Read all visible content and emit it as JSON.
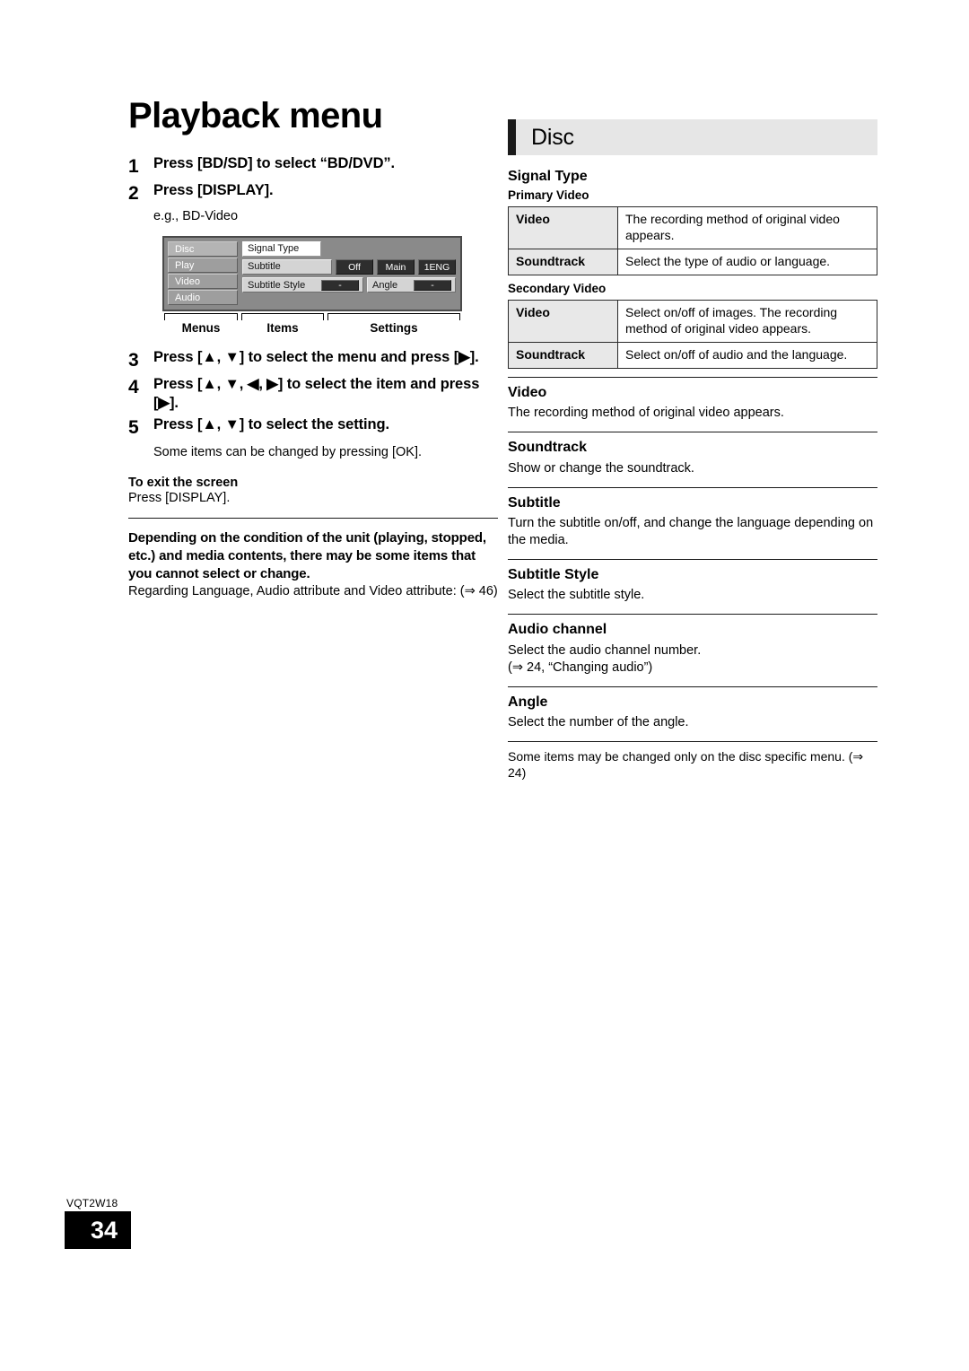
{
  "page": {
    "title": "Playback menu",
    "model_code": "VQT2W18",
    "page_number": "34"
  },
  "steps": [
    {
      "num": "1",
      "text": "Press [BD/SD] to select “BD/DVD”."
    },
    {
      "num": "2",
      "text": "Press [DISPLAY].",
      "sub": "e.g., BD-Video"
    },
    {
      "num": "3",
      "text": "Press [▲, ▼] to select the menu and press [▶]."
    },
    {
      "num": "4",
      "text": "Press [▲, ▼, ◀, ▶] to select the item and press [▶]."
    },
    {
      "num": "5",
      "text": "Press [▲, ▼] to select the setting.",
      "sub": "Some items can be changed by pressing [OK]."
    }
  ],
  "osd": {
    "menus": [
      {
        "label": "Disc",
        "selected": true
      },
      {
        "label": "Play",
        "selected": false
      },
      {
        "label": "Video",
        "selected": false
      },
      {
        "label": "Audio",
        "selected": false
      }
    ],
    "rows": [
      {
        "item": "Signal Type",
        "style": "white"
      },
      {
        "item": "Subtitle",
        "values": [
          "Off",
          "Main",
          "1ENG"
        ]
      },
      {
        "item": "Subtitle Style",
        "values": [
          "-"
        ],
        "item2": "Angle",
        "values2": [
          "-"
        ]
      }
    ],
    "brackets": [
      {
        "label": "Menus"
      },
      {
        "label": "Items"
      },
      {
        "label": "Settings"
      }
    ]
  },
  "exit": {
    "heading": "To exit the screen",
    "body": "Press [DISPLAY]."
  },
  "warning": {
    "bold": "Depending on the condition of the unit (playing, stopped, etc.) and media contents, there may be some items that you cannot select or change.",
    "body": "Regarding Language, Audio attribute and Video attribute: (⇒ 46)"
  },
  "disc": {
    "header": "Disc",
    "signal_type": {
      "heading": "Signal Type",
      "primary": {
        "label": "Primary Video",
        "rows": [
          {
            "key": "Video",
            "desc": "The recording method of original video appears."
          },
          {
            "key": "Soundtrack",
            "desc": "Select the type of audio or language."
          }
        ]
      },
      "secondary": {
        "label": "Secondary Video",
        "rows": [
          {
            "key": "Video",
            "desc": "Select on/off of images. The recording method of original video appears."
          },
          {
            "key": "Soundtrack",
            "desc": "Select on/off of audio and the language."
          }
        ]
      }
    },
    "sections": [
      {
        "heading": "Video",
        "body": "The recording method of original video appears."
      },
      {
        "heading": "Soundtrack",
        "body": "Show or change the soundtrack."
      },
      {
        "heading": "Subtitle",
        "body": "Turn the subtitle on/off, and change the language depending on the media."
      },
      {
        "heading": "Subtitle Style",
        "body": "Select the subtitle style."
      },
      {
        "heading": "Audio channel",
        "body": "Select the audio channel number.\n(⇒ 24, “Changing audio”)"
      },
      {
        "heading": "Angle",
        "body": "Select the number of the angle."
      }
    ],
    "footnote": "Some items may be changed only on the disc specific menu. (⇒ 24)"
  }
}
